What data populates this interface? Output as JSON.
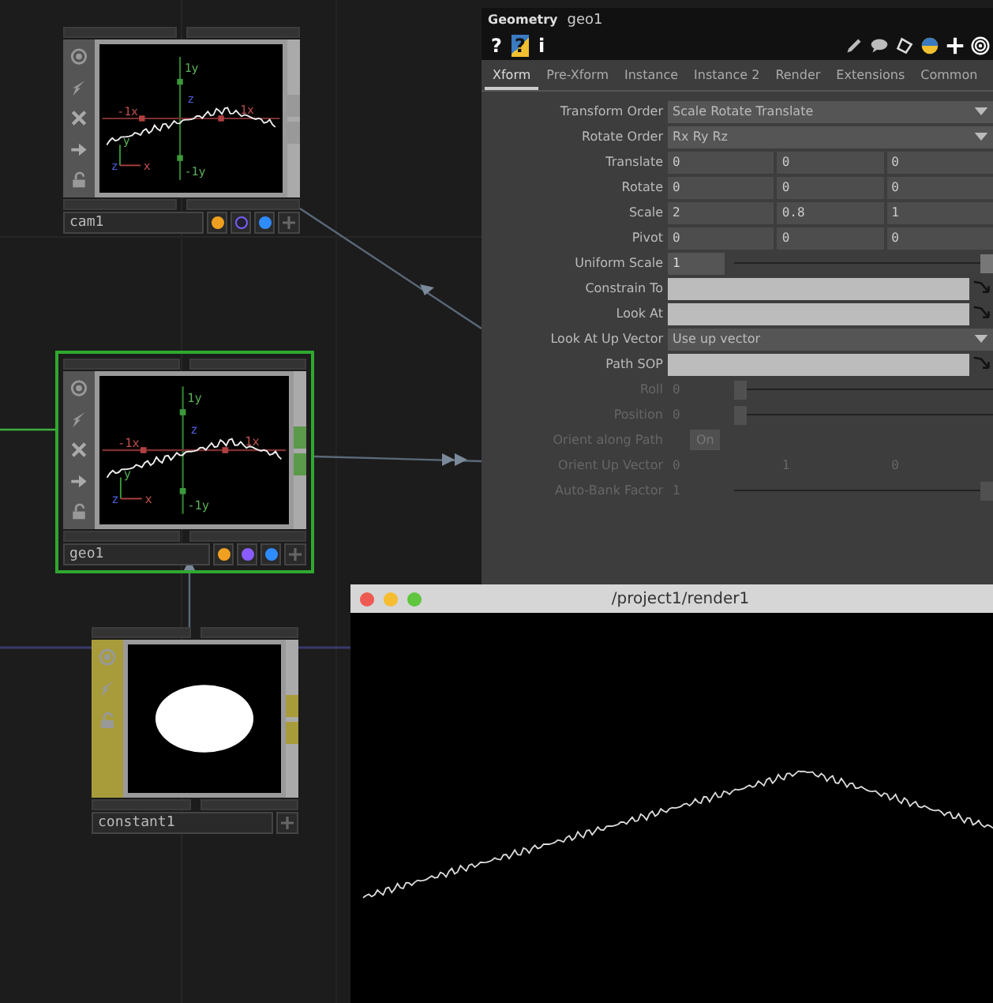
{
  "network": {
    "nodes": [
      {
        "name": "cam1",
        "kind": "comp",
        "selected": false,
        "axis_labels": {
          "y_top": "1y",
          "y_bottom": "-1y",
          "x_left": "-1x",
          "x_right": "1x",
          "z": "z",
          "gizmo_y": "y",
          "gizmo_x": "x",
          "gizmo_z": "z"
        },
        "flags": [
          {
            "color": "#f0a020",
            "on": true
          },
          {
            "color": "#7a5cff",
            "on": false
          },
          {
            "color": "#2f8cff",
            "on": true
          }
        ]
      },
      {
        "name": "geo1",
        "kind": "comp",
        "selected": true,
        "axis_labels": {
          "y_top": "1y",
          "y_bottom": "-1y",
          "x_left": "-1x",
          "x_right": "1x",
          "z": "z",
          "gizmo_y": "y",
          "gizmo_x": "x",
          "gizmo_z": "z"
        },
        "flags": [
          {
            "color": "#f0a020",
            "on": true
          },
          {
            "color": "#8a5cff",
            "on": true
          },
          {
            "color": "#2f8cff",
            "on": true
          }
        ]
      },
      {
        "name": "constant1",
        "kind": "top",
        "selected": false
      }
    ]
  },
  "parameters": {
    "type": "Geometry",
    "name": "geo1",
    "help_buttons": [
      {
        "label": "?",
        "kind": "plain"
      },
      {
        "label": "?",
        "kind": "python"
      },
      {
        "label": "i",
        "kind": "plain"
      }
    ],
    "tabs": [
      {
        "label": "Xform",
        "selected": true
      },
      {
        "label": "Pre-Xform",
        "selected": false
      },
      {
        "label": "Instance",
        "selected": false
      },
      {
        "label": "Instance 2",
        "selected": false
      },
      {
        "label": "Render",
        "selected": false
      },
      {
        "label": "Extensions",
        "selected": false
      },
      {
        "label": "Common",
        "selected": false
      }
    ],
    "rows": [
      {
        "label": "Transform Order",
        "kind": "menu",
        "value": "Scale Rotate Translate",
        "disabled": false
      },
      {
        "label": "Rotate Order",
        "kind": "menu",
        "value": "Rx Ry Rz",
        "disabled": false
      },
      {
        "label": "Translate",
        "kind": "xyz",
        "values": [
          "0",
          "0",
          "0"
        ],
        "disabled": false
      },
      {
        "label": "Rotate",
        "kind": "xyz",
        "values": [
          "0",
          "0",
          "0"
        ],
        "disabled": false
      },
      {
        "label": "Scale",
        "kind": "xyz",
        "values": [
          "2",
          "0.8",
          "1"
        ],
        "disabled": false
      },
      {
        "label": "Pivot",
        "kind": "xyz",
        "values": [
          "0",
          "0",
          "0"
        ],
        "disabled": false
      },
      {
        "label": "Uniform Scale",
        "kind": "slider",
        "value": "1",
        "level": 1,
        "disabled": false
      },
      {
        "label": "Constrain To",
        "kind": "path",
        "disabled": false
      },
      {
        "label": "Look At",
        "kind": "path",
        "disabled": false
      },
      {
        "label": "Look At Up Vector",
        "kind": "menu",
        "value": "Use up vector",
        "disabled": false
      },
      {
        "label": "Path SOP",
        "kind": "path",
        "disabled": false
      },
      {
        "label": "Roll",
        "kind": "slider",
        "value": "0",
        "level": 0,
        "disabled": true
      },
      {
        "label": "Position",
        "kind": "slider",
        "value": "0",
        "level": 0,
        "disabled": true
      },
      {
        "label": "Orient along Path",
        "kind": "toggle",
        "value": "On",
        "disabled": true
      },
      {
        "label": "Orient Up Vector",
        "kind": "xyz",
        "values": [
          "0",
          "1",
          "0"
        ],
        "disabled": true
      },
      {
        "label": "Auto-Bank Factor",
        "kind": "slider",
        "value": "1",
        "level": 1,
        "disabled": true
      }
    ]
  },
  "render_window": {
    "title": "/project1/render1"
  }
}
